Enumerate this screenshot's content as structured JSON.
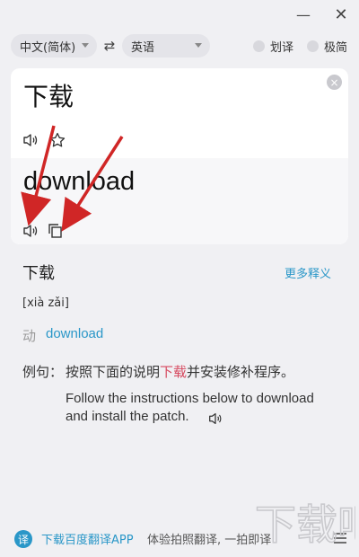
{
  "titlebar": {
    "minimize": "—",
    "close": "✕"
  },
  "langbar": {
    "source_lang": "中文(简体)",
    "target_lang": "英语",
    "swap": "⇄",
    "toggles": [
      {
        "label": "划译"
      },
      {
        "label": "极简"
      }
    ]
  },
  "translation": {
    "source_text": "下载",
    "target_text": "download",
    "clear": "×"
  },
  "dictionary": {
    "headword": "下载",
    "more_link": "更多释义",
    "phonetic": "[xià zǎi]",
    "pos": "动",
    "pos_meaning": "download",
    "example_label": "例句：",
    "example_cn_before": "按照下面的说明",
    "example_cn_highlight": "下载",
    "example_cn_after": "并安装修补程序。",
    "example_en": "Follow the instructions below to download and install the patch."
  },
  "footer": {
    "app_link": "下载百度翻译APP",
    "app_desc": "体验拍照翻译, 一拍即译",
    "logo_glyph": "译"
  },
  "watermark": "下载吧",
  "colors": {
    "accent": "#2a97c8",
    "highlight": "#d6495f",
    "arrow": "#d02626"
  },
  "icons": [
    "speaker-icon",
    "star-icon",
    "copy-icon",
    "close-icon",
    "swap-icon",
    "menu-icon"
  ]
}
